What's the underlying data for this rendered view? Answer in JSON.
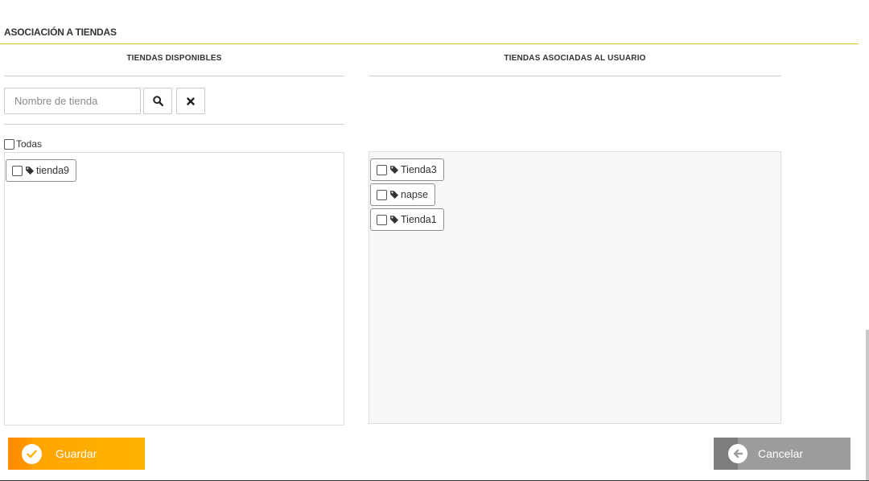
{
  "section": {
    "title": "ASOCIACIÓN A TIENDAS"
  },
  "available": {
    "header": "TIENDAS DISPONIBLES",
    "search": {
      "placeholder": "Nombre de tienda",
      "value": "",
      "search_icon": "search-icon",
      "clear_icon": "close-icon"
    },
    "select_all_label": "Todas",
    "items": [
      {
        "label": "tienda9"
      }
    ]
  },
  "associated": {
    "header": "TIENDAS ASOCIADAS AL USUARIO",
    "items": [
      {
        "label": "Tienda3"
      },
      {
        "label": "napse"
      },
      {
        "label": "Tienda1"
      }
    ]
  },
  "actions": {
    "save_label": "Guardar",
    "save_icon": "check-circle-icon",
    "cancel_label": "Cancelar",
    "cancel_icon": "arrow-left-circle-icon"
  },
  "colors": {
    "accent": "#ffb300",
    "accent_dark": "#ff8a00",
    "title_rule": "#f0c419",
    "cancel": "#9c9c9c",
    "cancel_dark": "#7d7d7d"
  }
}
